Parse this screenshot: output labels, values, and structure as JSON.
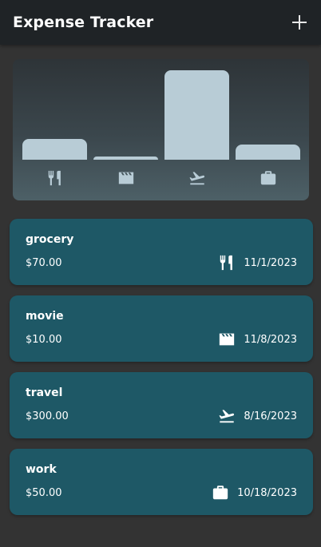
{
  "app": {
    "title": "Expense Tracker",
    "add_icon": "plus-icon"
  },
  "chart_data": {
    "type": "bar",
    "categories": [
      "food",
      "leisure",
      "travel",
      "work"
    ],
    "category_icons": [
      "fork-knife-icon",
      "movie-clapper-icon",
      "flight-takeoff-icon",
      "briefcase-icon"
    ],
    "values": [
      70,
      10,
      300,
      50
    ],
    "ylim": [
      0,
      300
    ],
    "bar_color": "#b8ccd6",
    "grid": false
  },
  "expenses": [
    {
      "title": "grocery",
      "amount": "$70.00",
      "date": "11/1/2023",
      "icon": "fork-knife-icon"
    },
    {
      "title": "movie",
      "amount": "$10.00",
      "date": "11/8/2023",
      "icon": "movie-clapper-icon"
    },
    {
      "title": "travel",
      "amount": "$300.00",
      "date": "8/16/2023",
      "icon": "flight-takeoff-icon"
    },
    {
      "title": "work",
      "amount": "$50.00",
      "date": "10/18/2023",
      "icon": "briefcase-icon"
    }
  ],
  "colors": {
    "card": "#1e5866",
    "appbar": "#1f2326",
    "background": "#333333"
  }
}
